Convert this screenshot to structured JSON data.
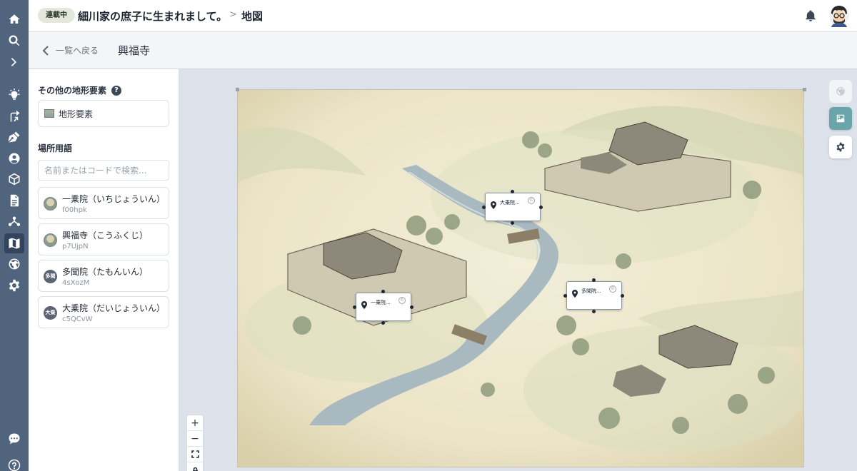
{
  "header": {
    "status_badge": "連載中",
    "work_title": "細川家の庶子に生まれまして。",
    "separator": ">",
    "page_title": "地図"
  },
  "subheader": {
    "back_label": "一覧へ戻る",
    "title": "興福寺"
  },
  "sidebar": {
    "terrain_section_title": "その他の地形要素",
    "help_glyph": "?",
    "terrain_button_label": "地形要素",
    "places_section_title": "場所用語",
    "search_placeholder": "名前またはコードで検索...",
    "places": [
      {
        "name": "一乗院（いちじょういん）",
        "code": "f00hpk",
        "icon_text": ""
      },
      {
        "name": "興福寺（こうふくじ）",
        "code": "p7UjpN",
        "icon_text": ""
      },
      {
        "name": "多聞院（たもんいん）",
        "code": "4sXozM",
        "icon_text": "多聞"
      },
      {
        "name": "大乗院（だいじょういん）",
        "code": "c5QCvW",
        "icon_text": "大乗"
      }
    ]
  },
  "map": {
    "markers": [
      {
        "label": "大乗院...",
        "copy_glyph": "©"
      },
      {
        "label": "一乗院...",
        "copy_glyph": "©"
      },
      {
        "label": "多聞院...",
        "copy_glyph": "©"
      }
    ],
    "zoom": {
      "in": "+",
      "out": "−"
    }
  },
  "colors": {
    "rail": "#51647e",
    "accent": "#6aa5aa",
    "map_paper": "#efe9d2"
  },
  "icons": {
    "rail": [
      "home-icon",
      "search-icon",
      "chevron-right-icon",
      "lightbulb-icon",
      "branch-arrow-icon",
      "pen-nib-icon",
      "user-circle-icon",
      "cube-icon",
      "document-icon",
      "network-icon",
      "map-icon",
      "globe-icon",
      "gear-icon",
      "chat-icon",
      "help-icon"
    ],
    "floating": [
      "globe-icon",
      "image-icon",
      "gear-icon"
    ]
  }
}
